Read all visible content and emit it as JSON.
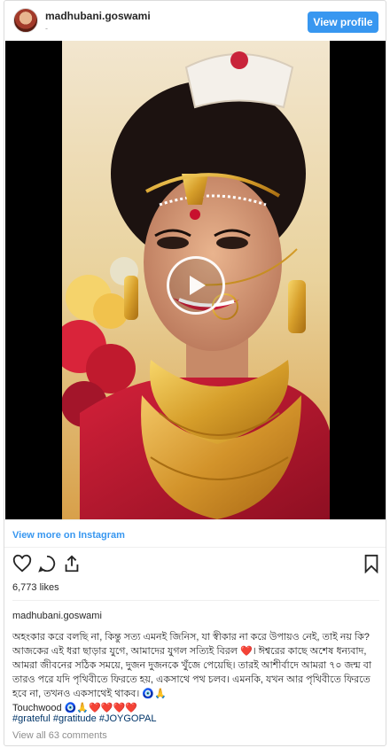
{
  "post": {
    "username": "madhubani.goswami",
    "sublabel": "-",
    "view_profile_label": "View profile"
  },
  "media": {
    "type": "video",
    "play_icon": "play-icon"
  },
  "footer": {
    "view_more_label": "View more on Instagram",
    "likes_text": "6,773 likes",
    "caption_username": "madhubani.goswami",
    "caption_text": "অহংকার করে বলছি না, কিন্তু সত্য এমনই জিনিস, যা স্বীকার না করে উপায়ও নেই, তাই নয় কি? আজকের এই ধরা ছাড়ার যুগে, আমাদের যুগল সত্যিই বিরল ❤️। ঈশ্বরের কাছে অশেষ ধন্যবাদ, আমরা জীবনের সঠিক সময়ে, দুজন দুজনকে খুঁজে পেয়েছি। তারই আশীর্বাদে আমরা ৭০ জন্ম বা তারও পরে যদি পৃথিবীতে ফিরতে হয়, একসাথে পথ চলব। এমনকি, যখন আর পৃথিবীতে ফিরতে হবে না, তখনও একসাথেই থাকব। 🧿🙏",
    "caption_last": "Touchwood 🧿🙏❤️❤️❤️❤️",
    "hashtags": "#grateful #gratitude #JOYGOPAL",
    "comments_link": "View all 63 comments"
  },
  "colors": {
    "accent": "#3897f0",
    "hashtag": "#003569",
    "muted": "#8e8e8e"
  },
  "icons": [
    "heart-icon",
    "comment-icon",
    "share-icon",
    "bookmark-icon",
    "play-icon"
  ]
}
